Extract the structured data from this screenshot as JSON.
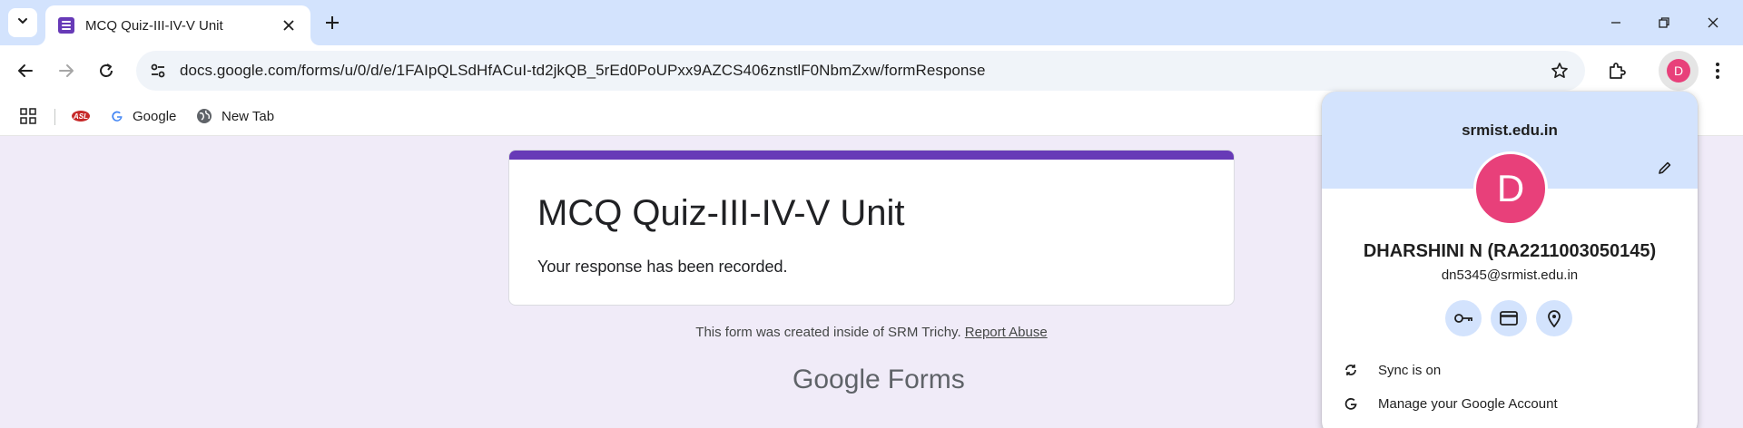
{
  "browser": {
    "tab": {
      "title": "MCQ Quiz-III-IV-V Unit",
      "favicon": "google-forms-icon"
    },
    "address_bar": {
      "url": "docs.google.com/forms/u/0/d/e/1FAIpQLSdHfACuI-td2jkQB_5rEd0PoUPxx9AZCS406znstlF0NbmZxw/formResponse"
    },
    "profile_initial": "D",
    "bookmarks": [
      {
        "label": "",
        "icon": "asl-logo-icon"
      },
      {
        "label": "Google",
        "icon": "google-g-icon"
      },
      {
        "label": "New Tab",
        "icon": "globe-icon"
      }
    ]
  },
  "form": {
    "title": "MCQ Quiz-III-IV-V Unit",
    "confirmation": "Your response has been recorded.",
    "footer_text": "This form was created inside of SRM Trichy.",
    "report_link": "Report Abuse",
    "brand_google": "Google",
    "brand_forms": "Forms",
    "accent_color": "#673ab7",
    "background_color": "#f0ebf8"
  },
  "profile_popup": {
    "domain": "srmist.edu.in",
    "avatar_letter": "D",
    "name": "DHARSHINI N (RA2211003050145)",
    "email": "dn5345@srmist.edu.in",
    "quick_actions": [
      "key-icon",
      "credit-card-icon",
      "location-pin-icon"
    ],
    "menu": [
      {
        "label": "Sync is on",
        "icon": "sync-icon"
      },
      {
        "label": "Manage your Google Account",
        "icon": "google-g-icon"
      }
    ],
    "avatar_color": "#e8407a"
  }
}
